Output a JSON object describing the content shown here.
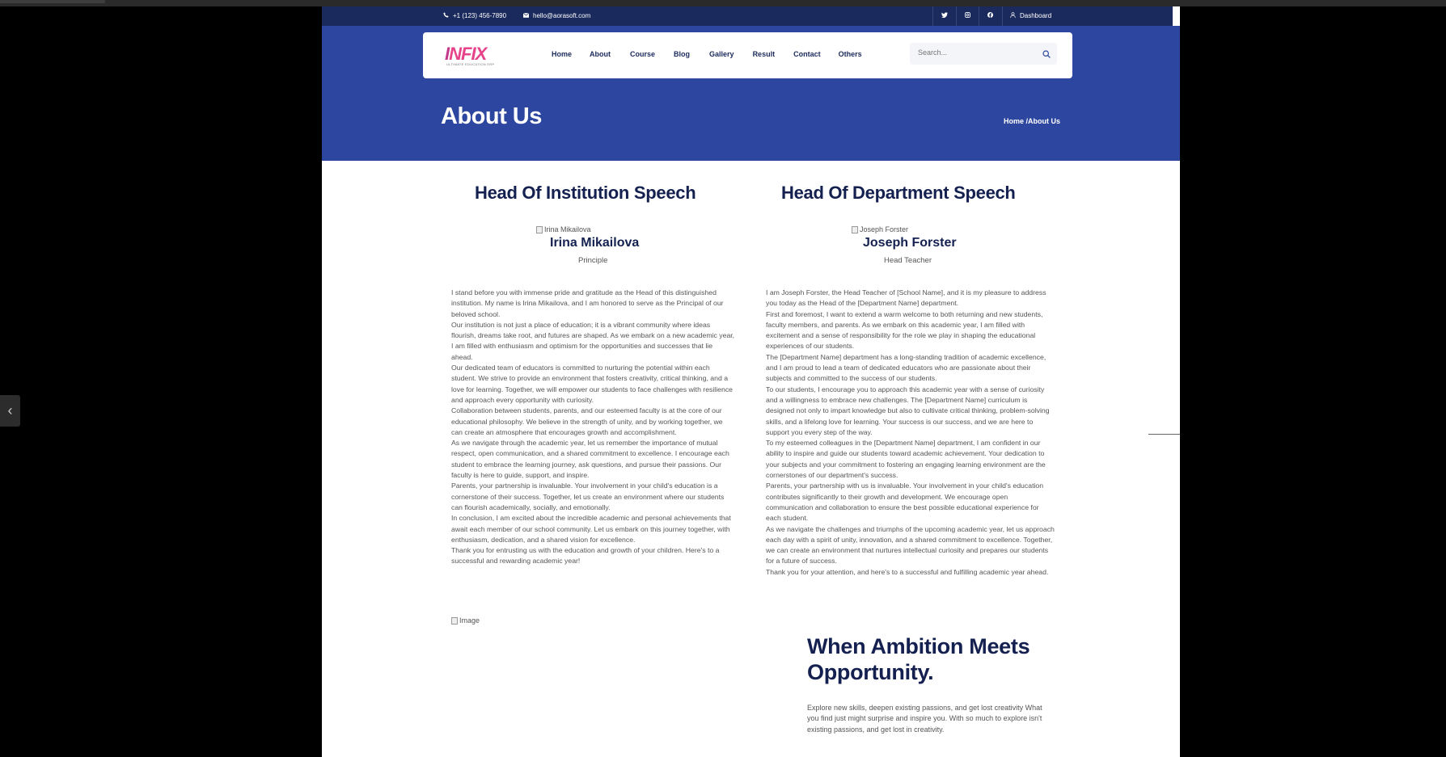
{
  "topbar": {
    "phone": "+1 (123) 456-7890",
    "email": "hello@aorasoft.com",
    "dashboard": "Dashboard"
  },
  "brand": {
    "logo_part1": "I",
    "logo_part2": "NFIX",
    "tagline": "ULTIMATE EDUCATION ERP"
  },
  "nav": {
    "items": [
      "Home",
      "About",
      "Course",
      "Blog",
      "Gallery",
      "Result",
      "Contact",
      "Others"
    ]
  },
  "search": {
    "placeholder": "Search..."
  },
  "hero": {
    "title": "About Us",
    "breadcrumb": "Home /About Us"
  },
  "institution": {
    "heading": "Head Of Institution Speech",
    "image_alt": "Irina Mikailova",
    "name": "Irina Mikailova",
    "role": "Principle",
    "paragraphs": [
      "I stand before you with immense pride and gratitude as the Head of this distinguished institution. My name is Irina Mikailova, and I am honored to serve as the Principal of our beloved school.",
      "Our institution is not just a place of education; it is a vibrant community where ideas flourish, dreams take root, and futures are shaped. As we embark on a new academic year, I am filled with enthusiasm and optimism for the opportunities and successes that lie ahead.",
      "Our dedicated team of educators is committed to nurturing the potential within each student. We strive to provide an environment that fosters creativity, critical thinking, and a love for learning. Together, we will empower our students to face challenges with resilience and approach every opportunity with curiosity.",
      "Collaboration between students, parents, and our esteemed faculty is at the core of our educational philosophy. We believe in the strength of unity, and by working together, we can create an atmosphere that encourages growth and accomplishment.",
      "As we navigate through the academic year, let us remember the importance of mutual respect, open communication, and a shared commitment to excellence. I encourage each student to embrace the learning journey, ask questions, and pursue their passions. Our faculty is here to guide, support, and inspire.",
      "Parents, your partnership is invaluable. Your involvement in your child's education is a cornerstone of their success. Together, let us create an environment where our students can flourish academically, socially, and emotionally.",
      "In conclusion, I am excited about the incredible academic and personal achievements that await each member of our school community. Let us embark on this journey together, with enthusiasm, dedication, and a shared vision for excellence.",
      "Thank you for entrusting us with the education and growth of your children. Here's to a successful and rewarding academic year!"
    ]
  },
  "department": {
    "heading": "Head Of Department Speech",
    "image_alt": "Joseph Forster",
    "name": "Joseph Forster",
    "role": "Head Teacher",
    "paragraphs": [
      "I am Joseph Forster, the Head Teacher of [School Name], and it is my pleasure to address you today as the Head of the [Department Name] department.",
      "First and foremost, I want to extend a warm welcome to both returning and new students, faculty members, and parents. As we embark on this academic year, I am filled with excitement and a sense of responsibility for the role we play in shaping the educational experiences of our students.",
      "The [Department Name] department has a long-standing tradition of academic excellence, and I am proud to lead a team of dedicated educators who are passionate about their subjects and committed to the success of our students.",
      "To our students, I encourage you to approach this academic year with a sense of curiosity and a willingness to embrace new challenges. The [Department Name] curriculum is designed not only to impart knowledge but also to cultivate critical thinking, problem-solving skills, and a lifelong love for learning. Your success is our success, and we are here to support you every step of the way.",
      "To my esteemed colleagues in the [Department Name] department, I am confident in our ability to inspire and guide our students toward academic achievement. Your dedication to your subjects and your commitment to fostering an engaging learning environment are the cornerstones of our department's success.",
      "Parents, your partnership with us is invaluable. Your involvement in your child's education contributes significantly to their growth and development. We encourage open communication and collaboration to ensure the best possible educational experience for each student.",
      "As we navigate the challenges and triumphs of the upcoming academic year, let us approach each day with a spirit of unity, innovation, and a shared commitment to excellence. Together, we can create an environment that nurtures intellectual curiosity and prepares our students for a future of success.",
      "Thank you for your attention, and here's to a successful and fulfilling academic year ahead."
    ]
  },
  "ambition": {
    "image_alt": "Image",
    "title": "When Ambition Meets Opportunity.",
    "text": "Explore new skills, deepen existing passions, and get lost creativity What you find just might surprise and inspire you. With so much to explore isn't existing passions, and get lost in creativity."
  },
  "colors": {
    "header_dark": "#1b2a5c",
    "hero_blue": "#2d46a0",
    "heading_navy": "#14204f",
    "logo_pink": "#e7438a"
  }
}
